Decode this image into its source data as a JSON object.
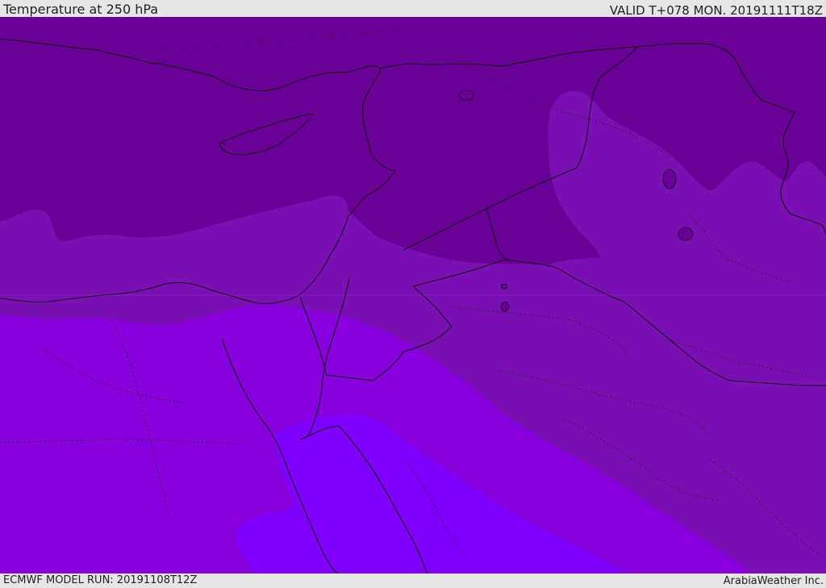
{
  "header": {
    "title": "Temperature at 250 hPa",
    "valid": "VALID T+078 MON. 20191111T18Z"
  },
  "footer": {
    "model_run": "ECMWF MODEL RUN: 20191108T12Z",
    "brand": "ArabiaWeather Inc."
  },
  "colors": {
    "band_coldest": "#6a0098",
    "band_cold": "#7a10b4",
    "band_mid": "#8800dc",
    "band_warm": "#8000ff",
    "border_line": "#111111"
  }
}
